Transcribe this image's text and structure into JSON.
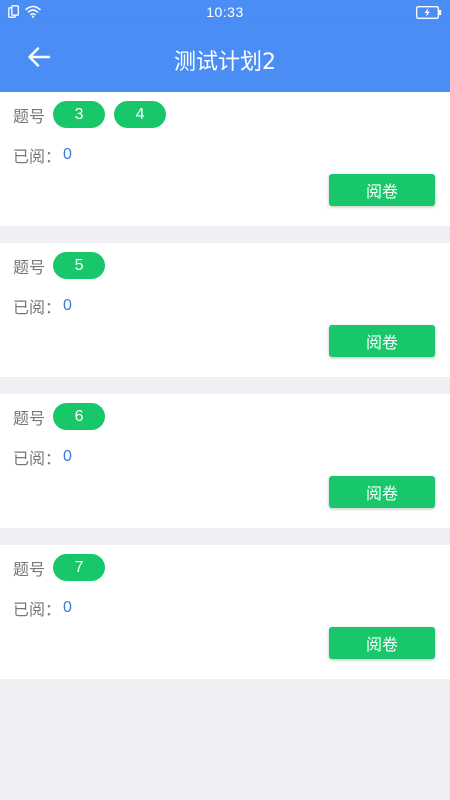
{
  "status_bar": {
    "time": "10:33"
  },
  "header": {
    "title": "测试计划2",
    "back_icon": "arrow-left-icon"
  },
  "colors": {
    "primary": "#4a8ef5",
    "accent_green": "#17c76a",
    "count_blue": "#3b7bd6",
    "background": "#efeef3"
  },
  "plans": [
    {
      "question_label": "题号",
      "questions": [
        "3",
        "4"
      ],
      "read_label": "已阅：",
      "read_count": "0",
      "grade_label": "阅卷"
    },
    {
      "question_label": "题号",
      "questions": [
        "5"
      ],
      "read_label": "已阅：",
      "read_count": "0",
      "grade_label": "阅卷"
    },
    {
      "question_label": "题号",
      "questions": [
        "6"
      ],
      "read_label": "已阅：",
      "read_count": "0",
      "grade_label": "阅卷"
    },
    {
      "question_label": "题号",
      "questions": [
        "7"
      ],
      "read_label": "已阅：",
      "read_count": "0",
      "grade_label": "阅卷"
    }
  ]
}
